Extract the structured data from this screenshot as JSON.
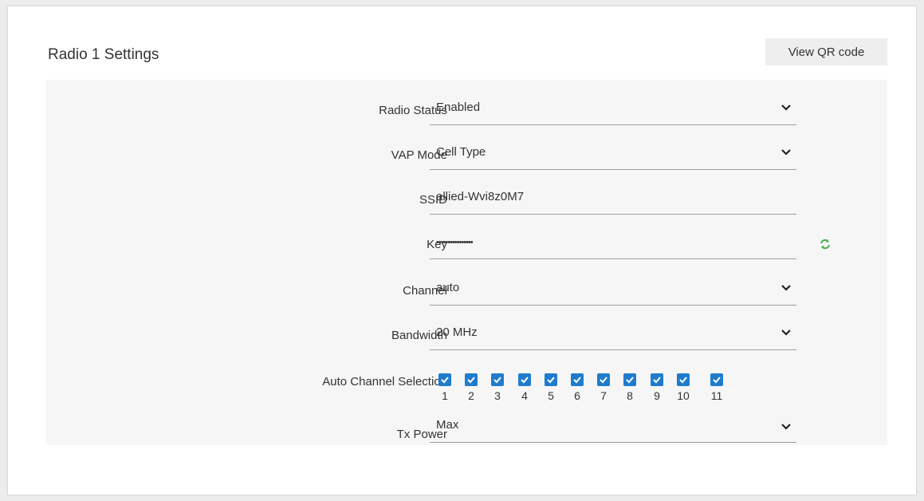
{
  "header": {
    "title": "Radio 1 Settings",
    "qr_button": "View QR code"
  },
  "form": {
    "radio_status": {
      "label": "Radio Status",
      "value": "Enabled"
    },
    "vap_mode": {
      "label": "VAP Mode",
      "value": "Cell Type"
    },
    "ssid": {
      "label": "SSID",
      "value": "allied-Wvi8z0M7"
    },
    "key": {
      "label": "Key",
      "value": "••••••••••••••••"
    },
    "channel": {
      "label": "Channel",
      "value": "auto"
    },
    "bandwidth": {
      "label": "Bandwidth",
      "value": "20 MHz"
    },
    "auto_channel": {
      "label": "Auto Channel Selection",
      "channels": [
        "1",
        "2",
        "3",
        "4",
        "5",
        "6",
        "7",
        "8",
        "9",
        "10",
        "11"
      ],
      "checked": [
        true,
        true,
        true,
        true,
        true,
        true,
        true,
        true,
        true,
        true,
        true
      ]
    },
    "tx_power": {
      "label": "Tx Power",
      "value": "Max"
    }
  },
  "colors": {
    "checkbox": "#1f7ccd",
    "refresh_icon": "#4caf50"
  },
  "icons": {
    "select_arrow": "chevron-down-icon",
    "regenerate_key": "refresh-icon",
    "checkbox_mark": "checkmark-icon"
  }
}
